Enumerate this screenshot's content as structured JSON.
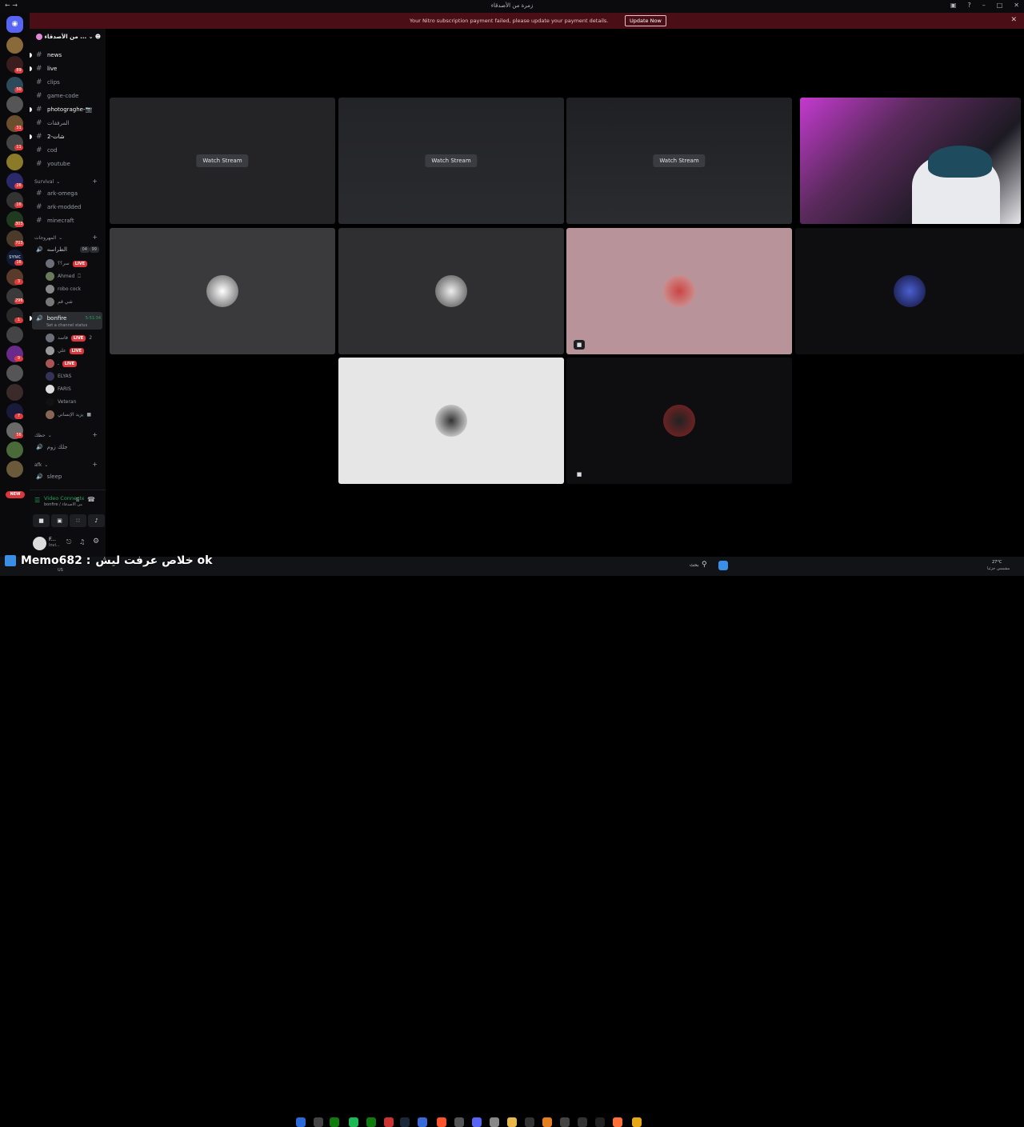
{
  "window": {
    "title": "زمرة من الأصدقاء",
    "nav_icons": [
      "back-icon",
      "forward-icon"
    ],
    "controls": [
      "inbox-icon",
      "help-icon",
      "minimize-icon",
      "maximize-icon",
      "close-icon"
    ]
  },
  "nitro_banner": {
    "message": "Your Nitro subscription payment failed, please update your payment details.",
    "button": "Update Now",
    "color": "#4a0e16"
  },
  "server_rail": {
    "badges": [
      "89",
      "50",
      "31",
      "11",
      "26",
      "16",
      "303",
      "703",
      "16",
      "3",
      "296",
      "1",
      "9",
      "7",
      "56"
    ],
    "sync_label": "SYNC",
    "new_label": "NEW"
  },
  "server": {
    "name": "من الأصدقاء ..."
  },
  "channels": [
    {
      "name": "news",
      "unread": true
    },
    {
      "name": "live",
      "unread": true
    },
    {
      "name": "clips",
      "unread": false
    },
    {
      "name": "game-code",
      "unread": false
    },
    {
      "name": "photograghe-📷",
      "unread": true
    },
    {
      "name": "المرفقات",
      "unread": false
    },
    {
      "name": "شات-2",
      "unread": true
    },
    {
      "name": "cod",
      "unread": false
    },
    {
      "name": "youtube",
      "unread": false
    }
  ],
  "categories": {
    "survival": "Survival",
    "survival_channels": [
      "ark-omega",
      "ark-modded",
      "minecraft"
    ],
    "voice": "المهروجات",
    "hangout": "حظك",
    "afk": "afk"
  },
  "voice_channels": {
    "main": {
      "name": "الطراسه",
      "counts": [
        "04",
        "99"
      ]
    },
    "main_users": [
      {
        "name": "سر؟؟",
        "live": true
      },
      {
        "name": "Ahmed",
        "live": false
      },
      {
        "name": "robo cock",
        "live": false
      },
      {
        "name": "شي قم",
        "live": false
      }
    ],
    "bonfire": {
      "name": "bonfire",
      "timer": "5:51:34",
      "status": "Set a channel status"
    },
    "bonfire_users": [
      {
        "name": "فاسد",
        "live": true,
        "count": "2"
      },
      {
        "name": "علي",
        "live": true
      },
      {
        "name": "ـ",
        "live": true
      },
      {
        "name": "ELYAS",
        "live": false
      },
      {
        "name": "FARIS",
        "live": false
      },
      {
        "name": "Veteran",
        "live": false
      },
      {
        "name": "يزيد الإنساني",
        "live": false
      }
    ],
    "hangout_room": "جلك زوم",
    "afk_room": "sleep",
    "live_label": "LIVE"
  },
  "voice_panel": {
    "status": "Video Connected",
    "sub": "bonfire / من الأصدقاء"
  },
  "user_panel": {
    "name": "F...",
    "tag": "Invi..."
  },
  "stage": {
    "watch_label": "Watch Stream",
    "tiles": [
      {
        "kind": "stream",
        "bg": "#242427"
      },
      {
        "kind": "stream",
        "bg": "#232428"
      },
      {
        "kind": "stream",
        "bg": "#25262a"
      },
      {
        "kind": "camera",
        "bg": "#5a2a5c"
      },
      {
        "kind": "avatar",
        "bg": "#3a3a3c"
      },
      {
        "kind": "avatar",
        "bg": "#2f2f31"
      },
      {
        "kind": "avatar",
        "bg": "#b8939a",
        "cam_icon": true
      },
      {
        "kind": "avatar",
        "bg": "#0e0e10"
      },
      {
        "kind": "avatar",
        "bg": "#e6e6e6"
      },
      {
        "kind": "avatar",
        "bg": "#0e0e10",
        "cam_icon": true
      }
    ]
  },
  "caption": {
    "name": "Memo682 :",
    "text": "خلاص عرفت ليش ok"
  },
  "taskbar": {
    "search": "بحث",
    "temperature": "27°C",
    "weather": "مشمس جزئيا",
    "lang": "US"
  }
}
